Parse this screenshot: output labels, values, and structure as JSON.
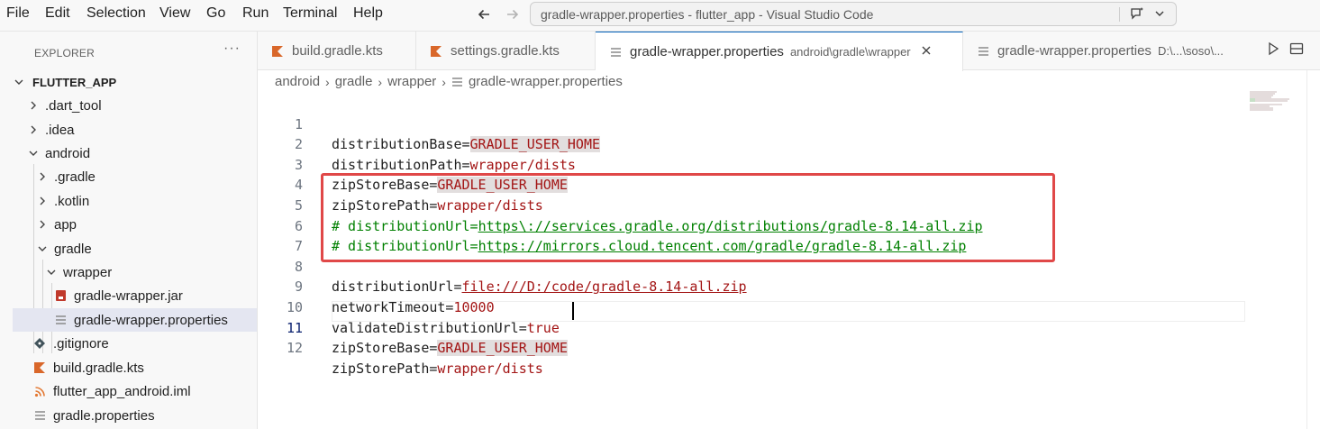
{
  "menu": {
    "items": [
      "File",
      "Edit",
      "Selection",
      "View",
      "Go",
      "Run",
      "Terminal",
      "Help"
    ]
  },
  "title_bar": {
    "command_center_text": "gradle-wrapper.properties - flutter_app - Visual Studio Code",
    "back_icon": "arrow-left-icon",
    "forward_icon": "arrow-right-icon"
  },
  "sidebar": {
    "title": "EXPLORER",
    "more": "···",
    "root": "FLUTTER_APP",
    "items": [
      {
        "label": ".dart_tool",
        "type": "folder",
        "state": "collapsed"
      },
      {
        "label": ".idea",
        "type": "folder",
        "state": "collapsed"
      },
      {
        "label": "android",
        "type": "folder",
        "state": "expanded"
      },
      {
        "label": ".gradle",
        "type": "folder",
        "state": "collapsed"
      },
      {
        "label": ".kotlin",
        "type": "folder",
        "state": "collapsed"
      },
      {
        "label": "app",
        "type": "folder",
        "state": "collapsed"
      },
      {
        "label": "gradle",
        "type": "folder",
        "state": "expanded"
      },
      {
        "label": "wrapper",
        "type": "folder",
        "state": "expanded"
      },
      {
        "label": "gradle-wrapper.jar",
        "type": "file",
        "icon": "jar-file-icon"
      },
      {
        "label": "gradle-wrapper.properties",
        "type": "file",
        "icon": "properties-file-icon",
        "selected": true
      },
      {
        "label": ".gitignore",
        "type": "file",
        "icon": "git-icon"
      },
      {
        "label": "build.gradle.kts",
        "type": "file",
        "icon": "kotlin-icon"
      },
      {
        "label": "flutter_app_android.iml",
        "type": "file",
        "icon": "rss-icon"
      },
      {
        "label": "gradle.properties",
        "type": "file",
        "icon": "properties-file-icon"
      }
    ]
  },
  "tabs": [
    {
      "label": "build.gradle.kts",
      "description": "",
      "icon": "kotlin-icon",
      "active": false
    },
    {
      "label": "settings.gradle.kts",
      "description": "",
      "icon": "kotlin-icon",
      "active": false
    },
    {
      "label": "gradle-wrapper.properties",
      "description": "android\\gradle\\wrapper",
      "icon": "properties-file-icon",
      "active": true
    },
    {
      "label": "gradle-wrapper.properties",
      "description": "D:\\...\\soso\\...",
      "icon": "properties-file-icon",
      "active": false
    }
  ],
  "breadcrumb": [
    "android",
    "gradle",
    "wrapper",
    "gradle-wrapper.properties"
  ],
  "editor": {
    "current_line": 11,
    "lines": [
      {
        "n": "1",
        "key": "distributionBase=",
        "val": "GRADLE_USER_HOME"
      },
      {
        "n": "2",
        "key": "distributionPath=",
        "val": "wrapper/dists"
      },
      {
        "n": "3",
        "key": "zipStoreBase=",
        "val": "GRADLE_USER_HOME"
      },
      {
        "n": "4",
        "key": "zipStorePath=",
        "val": "wrapper/dists"
      },
      {
        "n": "5",
        "comment": "# distributionUrl=",
        "url": "https\\://services.gradle.org/distributions/gradle-8.14-all.zip"
      },
      {
        "n": "6",
        "comment": "# distributionUrl=",
        "url": "https://mirrors.cloud.tencent.com/gradle/gradle-8.14-all.zip"
      },
      {
        "n": "7"
      },
      {
        "n": "8",
        "key": "distributionUrl=",
        "val": "file:///D:/code/gradle-8.14-all.zip"
      },
      {
        "n": "9",
        "key": "networkTimeout=",
        "val": "10000"
      },
      {
        "n": "10",
        "key": "validateDistributionUrl=",
        "val": "true"
      },
      {
        "n": "11",
        "key": "zipStoreBase=",
        "val": "GRADLE_USER_HOME"
      },
      {
        "n": "12",
        "key": "zipStorePath=",
        "val": "wrapper/dists"
      }
    ]
  },
  "colors": {
    "accent": "#005fb8",
    "highlight_box": "#e04848",
    "value": "#a31515",
    "comment": "#008000"
  }
}
